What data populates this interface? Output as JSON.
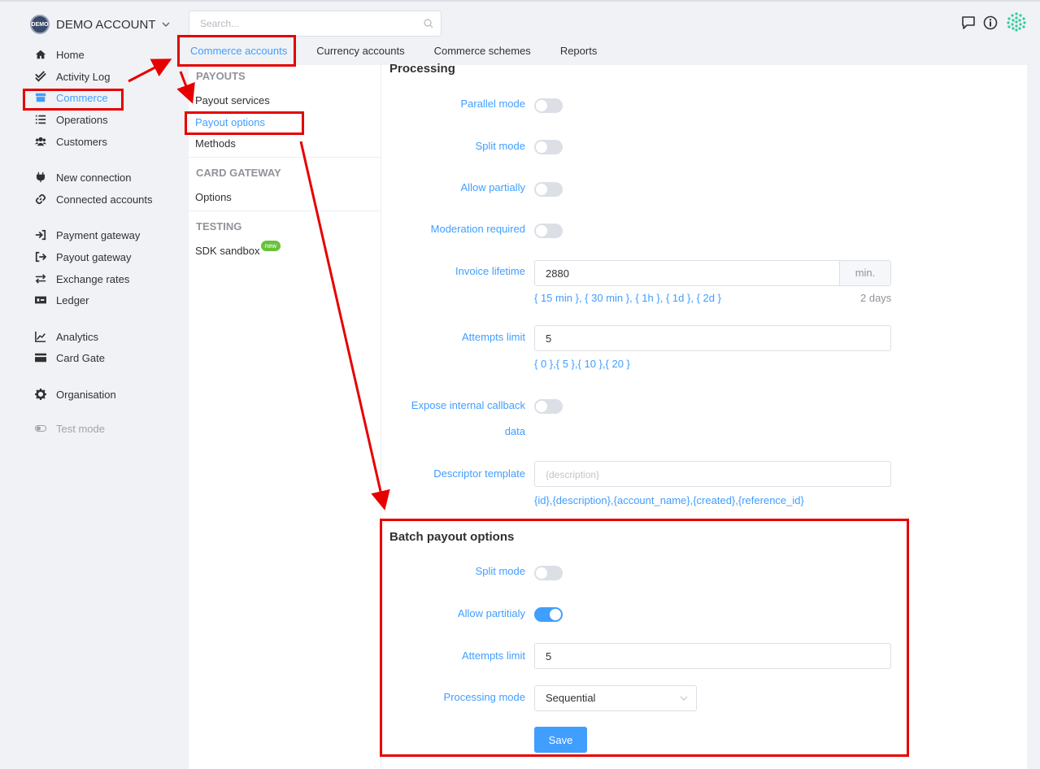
{
  "account": {
    "logo_text": "DEMO",
    "name": "DEMO ACCOUNT"
  },
  "sidebar": {
    "items": [
      {
        "label": "Home",
        "icon": "home-icon"
      },
      {
        "label": "Activity Log",
        "icon": "double-check-icon"
      },
      {
        "label": "Commerce",
        "icon": "store-icon"
      },
      {
        "label": "Operations",
        "icon": "list-icon"
      },
      {
        "label": "Customers",
        "icon": "users-icon"
      },
      {
        "label": "New connection",
        "icon": "plug-icon"
      },
      {
        "label": "Connected accounts",
        "icon": "link-icon"
      },
      {
        "label": "Payment gateway",
        "icon": "sign-in-icon"
      },
      {
        "label": "Payout gateway",
        "icon": "sign-out-icon"
      },
      {
        "label": "Exchange rates",
        "icon": "exchange-icon"
      },
      {
        "label": "Ledger",
        "icon": "money-bill-icon"
      },
      {
        "label": "Analytics",
        "icon": "chart-line-icon"
      },
      {
        "label": "Card Gate",
        "icon": "credit-card-icon"
      },
      {
        "label": "Organisation",
        "icon": "gear-icon"
      },
      {
        "label": "Test mode",
        "icon": "toggle-icon"
      }
    ]
  },
  "search": {
    "placeholder": "Search..."
  },
  "tabs": [
    "Commerce accounts",
    "Currency accounts",
    "Commerce schemes",
    "Reports"
  ],
  "submenu": {
    "payouts_heading": "PAYOUTS",
    "payouts": [
      "Payout services",
      "Payout options",
      "Methods"
    ],
    "card_gateway_heading": "CARD GATEWAY",
    "card_gateway": [
      "Options"
    ],
    "testing_heading": "TESTING",
    "testing": [
      "SDK sandbox"
    ],
    "new_badge": "new"
  },
  "processing": {
    "title": "Processing",
    "parallel_mode": {
      "label": "Parallel mode",
      "on": false
    },
    "split_mode": {
      "label": "Split mode",
      "on": false
    },
    "allow_partially": {
      "label": "Allow partially",
      "on": false
    },
    "moderation_required": {
      "label": "Moderation required",
      "on": false
    },
    "invoice_lifetime": {
      "label": "Invoice lifetime",
      "value": "2880",
      "unit": "min.",
      "presets": [
        "{ 15 min }",
        "{ 30 min }",
        "{ 1h }",
        "{ 1d }",
        "{ 2d }"
      ],
      "readable": "2 days"
    },
    "attempts_limit": {
      "label": "Attempts limit",
      "value": "5",
      "presets": [
        "{ 0 }",
        "{ 5 }",
        "{ 10 }",
        "{ 20 }"
      ]
    },
    "expose_callback": {
      "label_line1": "Expose internal callback",
      "label_line2": "data",
      "on": false
    },
    "descriptor_template": {
      "label": "Descriptor template",
      "placeholder": "{description}",
      "vars": [
        "{id}",
        "{description}",
        "{account_name}",
        "{created}",
        "{reference_id}"
      ]
    }
  },
  "batch": {
    "title": "Batch payout options",
    "split_mode": {
      "label": "Split mode",
      "on": false
    },
    "allow_partially": {
      "label": "Allow partitialy",
      "on": true
    },
    "attempts_limit": {
      "label": "Attempts limit",
      "value": "5"
    },
    "processing_mode": {
      "label": "Processing mode",
      "value": "Sequential"
    },
    "save_label": "Save"
  },
  "colors": {
    "accent": "#409eff",
    "annotation": "#e60000",
    "badge": "#67c23a"
  }
}
